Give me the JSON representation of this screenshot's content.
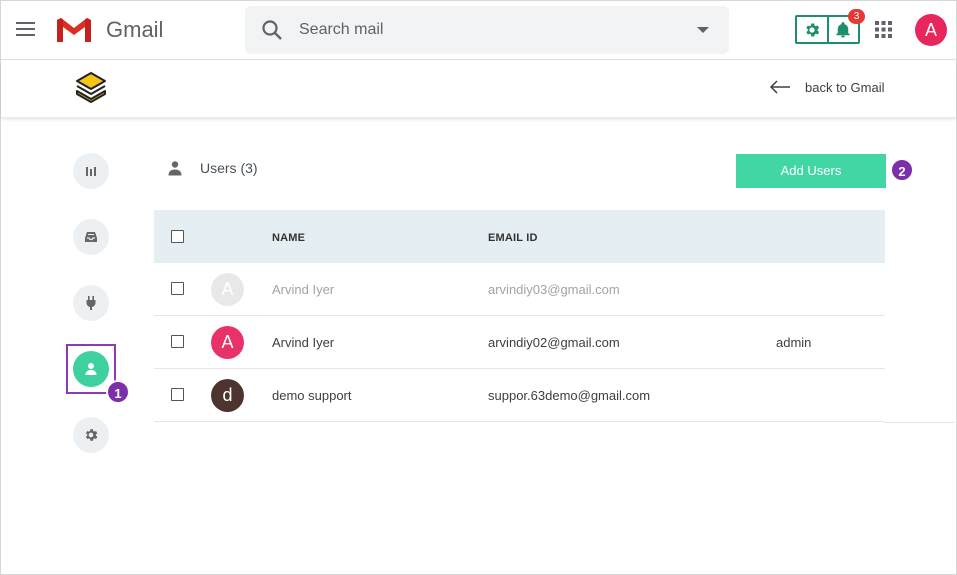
{
  "gmail": {
    "app_name": "Gmail",
    "search_placeholder": "Search mail",
    "notification_count": "3",
    "account_initial": "A",
    "accent": "#1e8e6e"
  },
  "extension": {
    "back_label": "back to Gmail"
  },
  "sidebar": {
    "items": [
      {
        "name": "analytics",
        "icon": "bar-chart-icon"
      },
      {
        "name": "inbox",
        "icon": "inbox-tray-icon"
      },
      {
        "name": "integrations",
        "icon": "plug-icon"
      },
      {
        "name": "users",
        "icon": "user-icon",
        "active": true
      },
      {
        "name": "settings",
        "icon": "gear-icon"
      }
    ]
  },
  "steps": {
    "step1": "1",
    "step2": "2"
  },
  "users": {
    "heading": "Users (3)",
    "add_button": "Add Users",
    "columns": {
      "name": "NAME",
      "email": "EMAIL ID"
    },
    "rows": [
      {
        "initial": "A",
        "name": "Arvind Iyer",
        "email": "arvindiy03@gmail.com",
        "role": "",
        "avatar_color": "#e8e8e8",
        "muted": true
      },
      {
        "initial": "A",
        "name": "Arvind Iyer",
        "email": "arvindiy02@gmail.com",
        "role": "admin",
        "avatar_color": "#e8326a",
        "muted": false
      },
      {
        "initial": "d",
        "name": "demo support",
        "email": "suppor.63demo@gmail.com",
        "role": "",
        "avatar_color": "#4e342e",
        "muted": false
      }
    ]
  }
}
